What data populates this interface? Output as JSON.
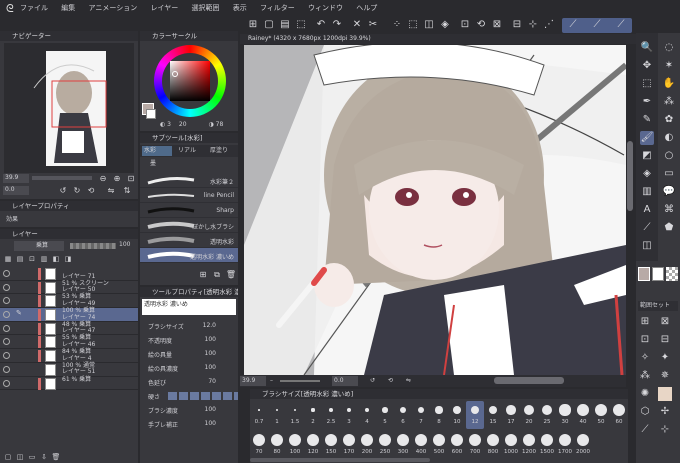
{
  "menu": [
    "ファイル",
    "編集",
    "アニメーション",
    "レイヤー",
    "選択範囲",
    "表示",
    "フィルター",
    "ウィンドウ",
    "ヘルプ"
  ],
  "navigator": {
    "title": "ナビゲーター",
    "zoom": "39.9",
    "angle": "0.0"
  },
  "color_circle": {
    "title": "カラーサークル",
    "h": "3",
    "s": "20",
    "v": "78",
    "main_color": "#b8aaa6"
  },
  "sub_tool": {
    "title": "サブツール[水彩]",
    "tabs": [
      "水彩",
      "リアル",
      "厚塗り"
    ],
    "group": "墨"
  },
  "brushes": [
    "水彩筆２",
    "line Pencil",
    "Sharp",
    "ぼかし水ブラシ",
    "透明水彩",
    "透明水彩 濃いめ"
  ],
  "layer_property": {
    "title": "レイヤープロパティ",
    "effect": "効果"
  },
  "layer_panel": {
    "title": "レイヤー",
    "blend": "乗算",
    "opacity": "100"
  },
  "layers": [
    {
      "top": "",
      "name": "レイヤー 71"
    },
    {
      "top": "51 % スクリーン",
      "name": "レイヤー 50"
    },
    {
      "top": "53 % 乗算",
      "name": "レイヤー 49"
    },
    {
      "top": "100 % 乗算",
      "name": "レイヤー 74"
    },
    {
      "top": "48 % 乗算",
      "name": "レイヤー 47"
    },
    {
      "top": "55 % 乗算",
      "name": "レイヤー 46"
    },
    {
      "top": "84 % 乗算",
      "name": "レイヤー 4"
    },
    {
      "top": "100 % 通常",
      "name": "レイヤー 51"
    },
    {
      "top": "61 % 乗算",
      "name": ""
    }
  ],
  "tool_property": {
    "title": "ツールプロパティ[透明水彩 濃いめ]",
    "brush_name": "透明水彩 濃いめ"
  },
  "props": [
    {
      "label": "ブラシサイズ",
      "value": "12.0"
    },
    {
      "label": "不透明度",
      "value": "100"
    },
    {
      "label": "絵の具量",
      "value": "100"
    },
    {
      "label": "絵の具濃度",
      "value": "100"
    },
    {
      "label": "色延び",
      "value": "70"
    },
    {
      "label": "硬さ",
      "value": ""
    },
    {
      "label": "ブラシ濃度",
      "value": "100"
    },
    {
      "label": "手ブレ補正",
      "value": "100"
    }
  ],
  "canvas": {
    "tab": "Rainey* (4320 x 7680px 1200dpi 39.9%)",
    "zoom": "39.9",
    "angle": "0.0"
  },
  "brush_size": {
    "title": "ブラシサイズ[透明水彩 濃いめ]",
    "row1": [
      "0.7",
      "1",
      "1.5",
      "2",
      "2.5",
      "3",
      "4",
      "5",
      "6",
      "7",
      "8",
      "10",
      "12",
      "15",
      "17",
      "20",
      "25",
      "30",
      "40",
      "50",
      "60"
    ],
    "row2": [
      "70",
      "80",
      "100",
      "120",
      "150",
      "170",
      "200",
      "250",
      "300",
      "400",
      "500",
      "600",
      "700",
      "800",
      "1000",
      "1200",
      "1500",
      "1700",
      "2000"
    ]
  },
  "right_panel": {
    "set_label": "範囲セット"
  },
  "swatches": [
    "#b8aaa6",
    "#ffffff",
    "#000000"
  ]
}
